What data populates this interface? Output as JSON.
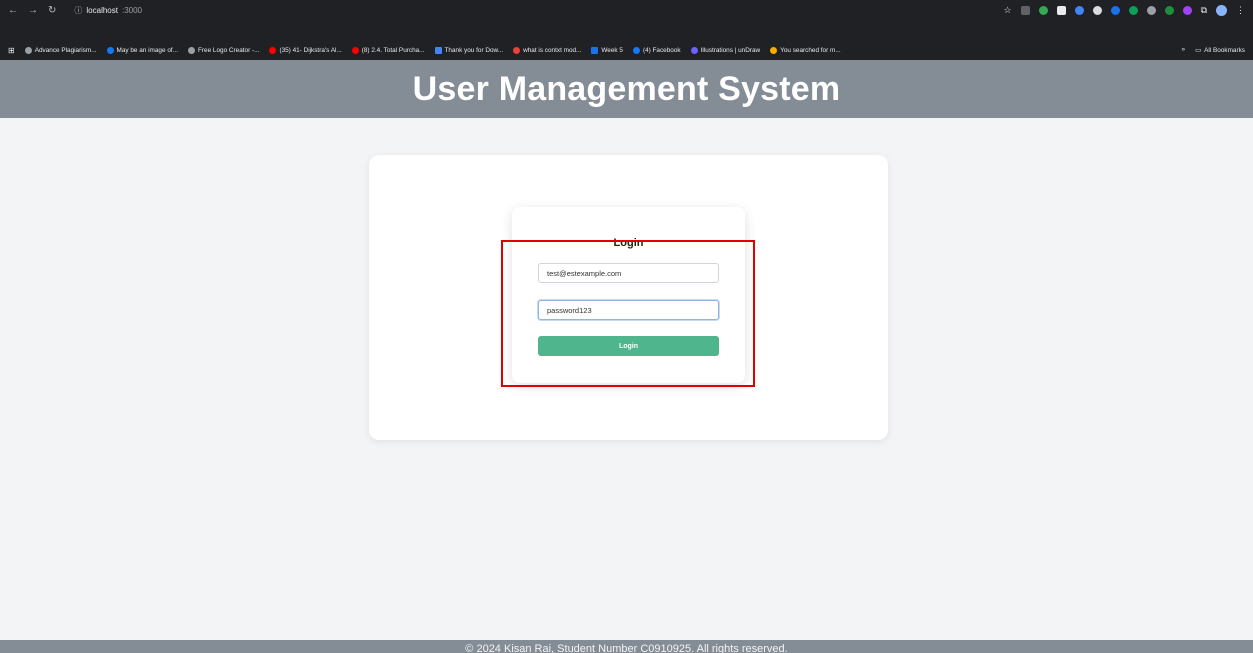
{
  "browser": {
    "url_host": "localhost",
    "url_port": ":3000",
    "back_icon": "arrow-left-icon",
    "forward_icon": "arrow-right-icon",
    "reload_icon": "reload-icon",
    "bookmarks": [
      "Advance Plagiarism...",
      "May be an image of...",
      "Free Logo Creator -...",
      "(35) 41- Dijkstra's Al...",
      "(8) 2.4. Total Purcha...",
      "Thank you for Dow...",
      "what is contxt mod...",
      "Week 5",
      "(4) Facebook",
      "Illustrations | unDraw",
      "You searched for m..."
    ],
    "bookmarks_overflow": "»",
    "all_bookmarks": "All Bookmarks"
  },
  "header": {
    "title": "User Management System"
  },
  "login": {
    "title": "Login",
    "email_value": "test@estexample.com",
    "password_value": "password123",
    "button_label": "Login"
  },
  "footer": {
    "text": "© 2024 Kisan Rai, Student Number C0910925. All rights reserved."
  },
  "colors": {
    "header_bg": "#848d96",
    "button_bg": "#4fb58d",
    "highlight": "#e00000"
  }
}
